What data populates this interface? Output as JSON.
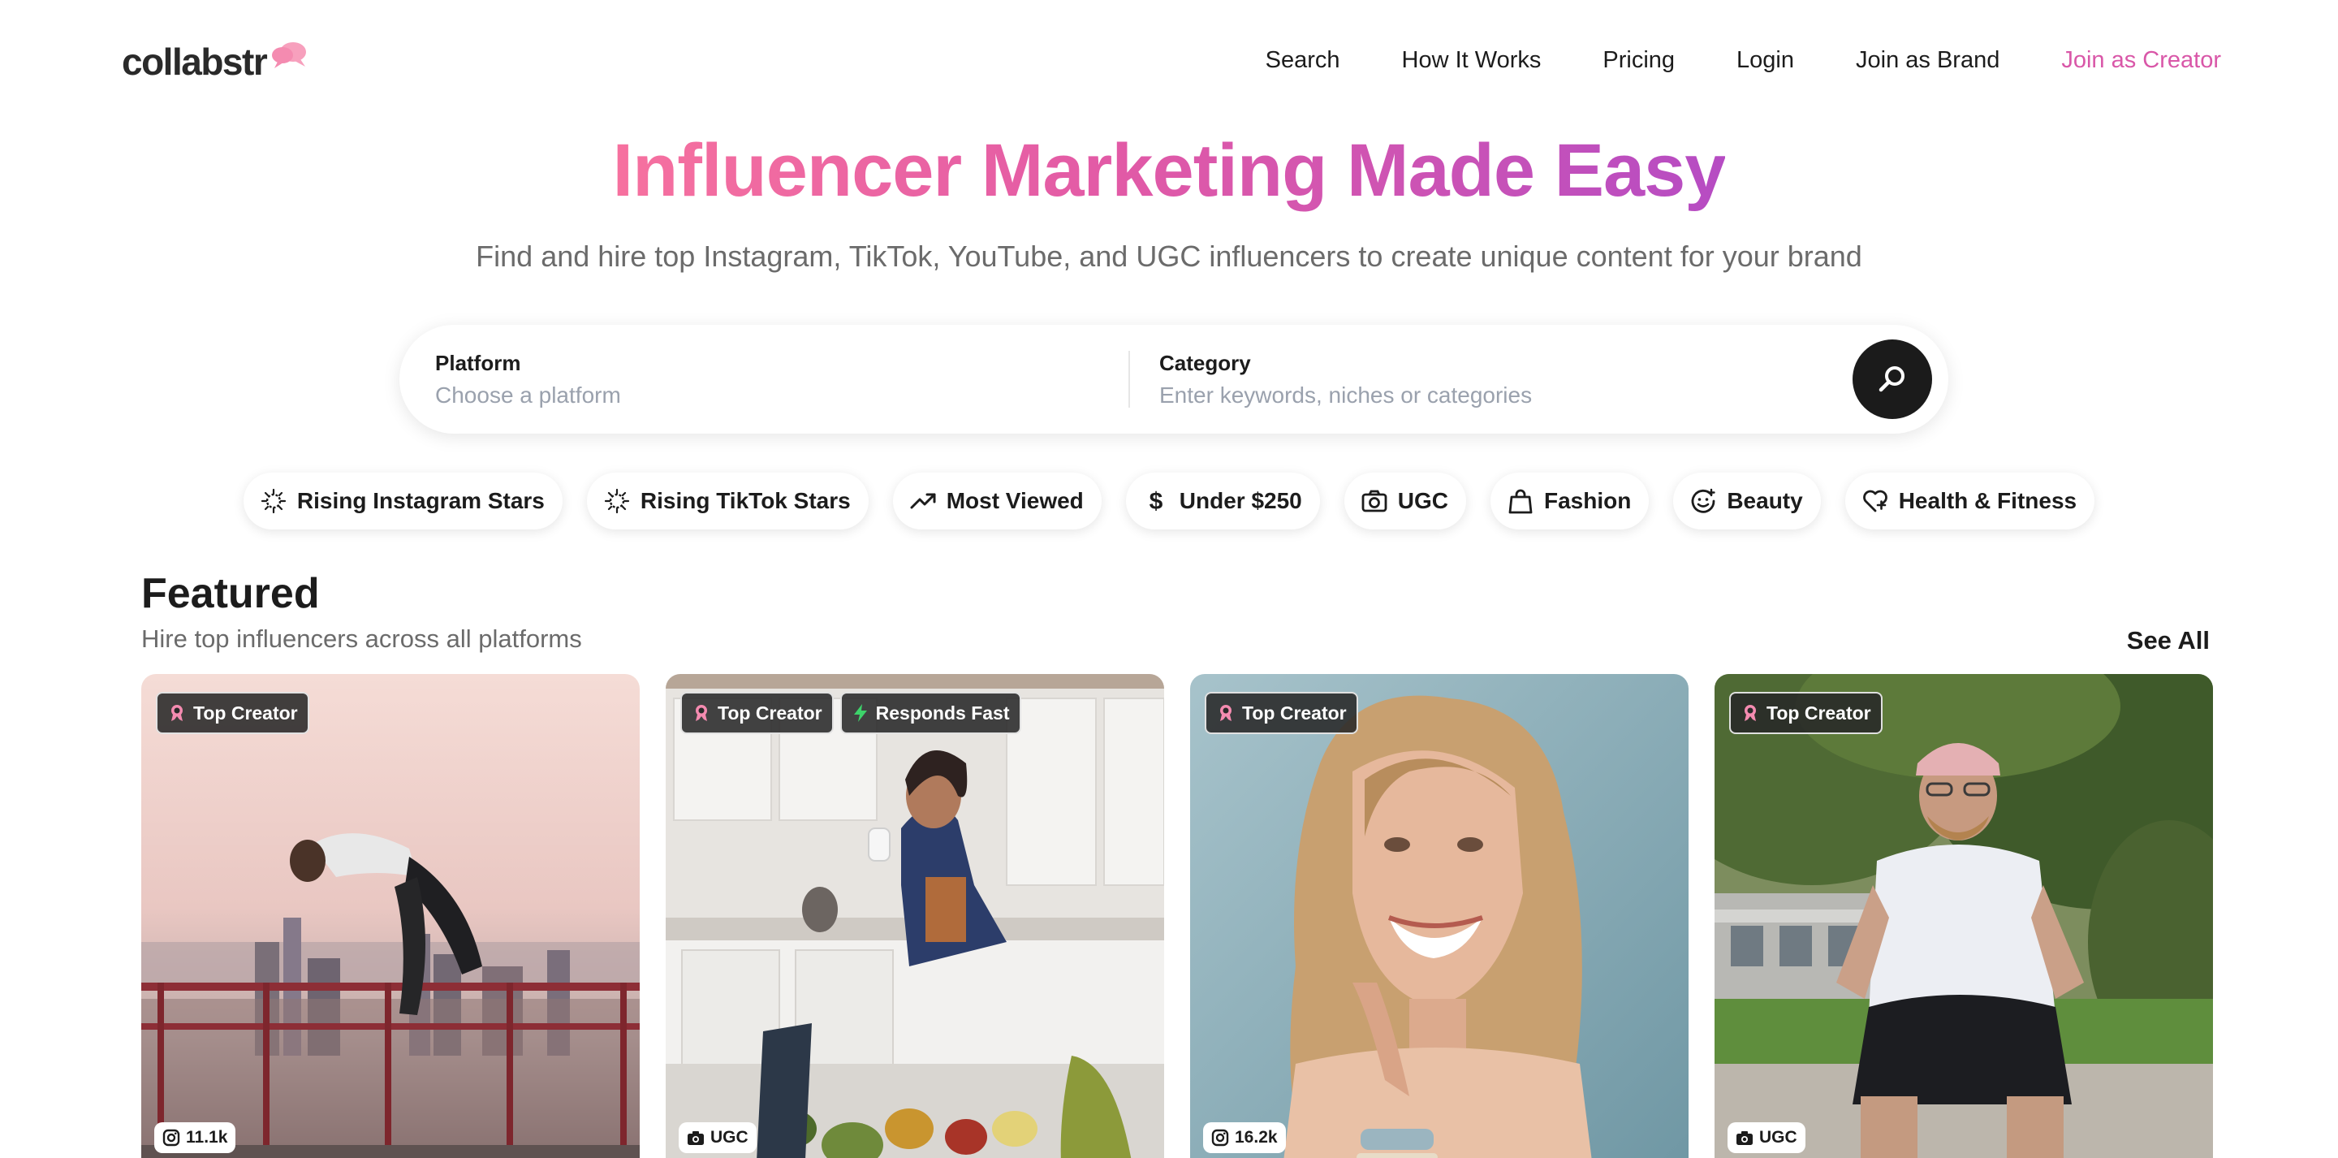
{
  "header": {
    "logo": "collabstr",
    "nav": [
      "Search",
      "How It Works",
      "Pricing",
      "Login",
      "Join as Brand",
      "Join as Creator"
    ]
  },
  "hero": {
    "title": "Influencer Marketing Made Easy",
    "subtitle": "Find and hire top Instagram, TikTok, YouTube, and UGC influencers to create unique content for your brand"
  },
  "search": {
    "platform_label": "Platform",
    "platform_placeholder": "Choose a platform",
    "category_label": "Category",
    "category_placeholder": "Enter keywords, niches or categories"
  },
  "chips": [
    {
      "label": "Rising Instagram Stars",
      "icon": "sparkle-icon"
    },
    {
      "label": "Rising TikTok Stars",
      "icon": "sparkle-icon"
    },
    {
      "label": "Most Viewed",
      "icon": "trending-up-icon"
    },
    {
      "label": "Under $250",
      "icon": "dollar-icon"
    },
    {
      "label": "UGC",
      "icon": "camera-icon"
    },
    {
      "label": "Fashion",
      "icon": "shopping-bag-icon"
    },
    {
      "label": "Beauty",
      "icon": "face-icon"
    },
    {
      "label": "Health & Fitness",
      "icon": "heart-pulse-icon"
    }
  ],
  "featured": {
    "title": "Featured",
    "subtitle": "Hire top influencers across all platforms",
    "see_all": "See All",
    "cards": [
      {
        "badges": [
          "Top Creator"
        ],
        "stat": "11.1k",
        "stat_icon": "instagram-icon"
      },
      {
        "badges": [
          "Top Creator",
          "Responds Fast"
        ],
        "stat": "UGC",
        "stat_icon": "camera-icon"
      },
      {
        "badges": [
          "Top Creator"
        ],
        "stat": "16.2k",
        "stat_icon": "instagram-icon"
      },
      {
        "badges": [
          "Top Creator"
        ],
        "stat": "UGC",
        "stat_icon": "camera-icon"
      }
    ]
  },
  "colors": {
    "accent_pink": "#d957a8",
    "gradient_start": "#f6719f",
    "gradient_end": "#b64cc3",
    "dark": "#1b1b1b"
  }
}
